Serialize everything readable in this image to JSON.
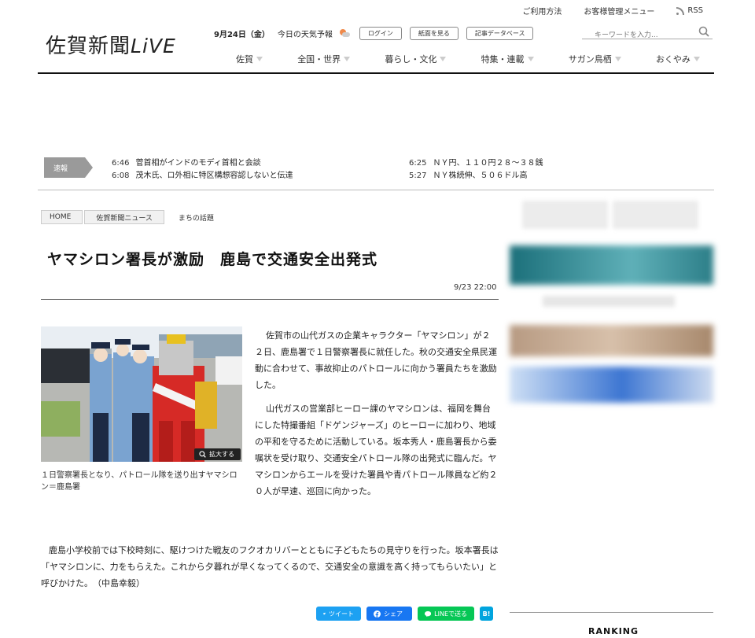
{
  "util_links": [
    "ご利用方法",
    "お客様管理メニュー",
    "RSS"
  ],
  "logo": {
    "main": "佐賀新聞",
    "live": "LiVE"
  },
  "header": {
    "date": "9月24日（金）",
    "weather_label": "今日の天気予報",
    "login": "ログイン",
    "paper_view": "紙面を見る",
    "article_db": "記事データベース",
    "search_placeholder": "キーワードを入力..."
  },
  "nav": [
    "佐賀",
    "全国・世界",
    "暮らし・文化",
    "特集・連載",
    "サガン鳥栖",
    "おくやみ"
  ],
  "breaking": {
    "label": "速報",
    "left": [
      {
        "time": "6:46",
        "text": "菅首相がインドのモディ首相と会談"
      },
      {
        "time": "6:08",
        "text": "茂木氏、ロ外相に特区構想容認しないと伝達"
      }
    ],
    "right": [
      {
        "time": "6:25",
        "text": "ＮＹ円、１１０円２８～３８銭"
      },
      {
        "time": "5:27",
        "text": "ＮＹ株続伸、５０６ドル高"
      }
    ]
  },
  "breadcrumb": [
    "HOME",
    "佐賀新聞ニュース",
    "まちの話題"
  ],
  "article": {
    "title": "ヤマシロン署長が激励　鹿島で交通安全出発式",
    "timestamp": "9/23 22:00",
    "zoom_label": "拡大する",
    "caption": "１日警察署長となり、パトロール隊を送り出すヤマシロン＝鹿島署",
    "para1": "佐賀市の山代ガスの企業キャラクター「ヤマシロン」が２２日、鹿島署で１日警察署長に就任した。秋の交通安全県民運動に合わせて、事故抑止のパトロールに向かう署員たちを激励した。",
    "para2": "山代ガスの営業部ヒーロー課のヤマシロンは、福岡を舞台にした特撮番組「ドゲンジャーズ」のヒーローに加わり、地域の平和を守るために活動している。坂本秀人・鹿島署長から委嘱状を受け取り、交通安全パトロール隊の出発式に臨んだ。ヤマシロンからエールを受けた署員や青パトロール隊員など約２０人が早速、巡回に向かった。",
    "para3": "鹿島小学校前では下校時刻に、駆けつけた戦友のフクオカリバーとともに子どもたちの見守りを行った。坂本署長は「ヤマシロンに、力をもらえた。これから夕暮れが早くなってくるので、交通安全の意識を高く持ってもらいたい」と呼びかけた。　（中島幸毅）"
  },
  "share": {
    "tweet": "ツイート",
    "facebook": "シェア",
    "line": "LINEで送る",
    "hatena": "B!"
  },
  "sidebar": {
    "ranking": "RANKING"
  }
}
